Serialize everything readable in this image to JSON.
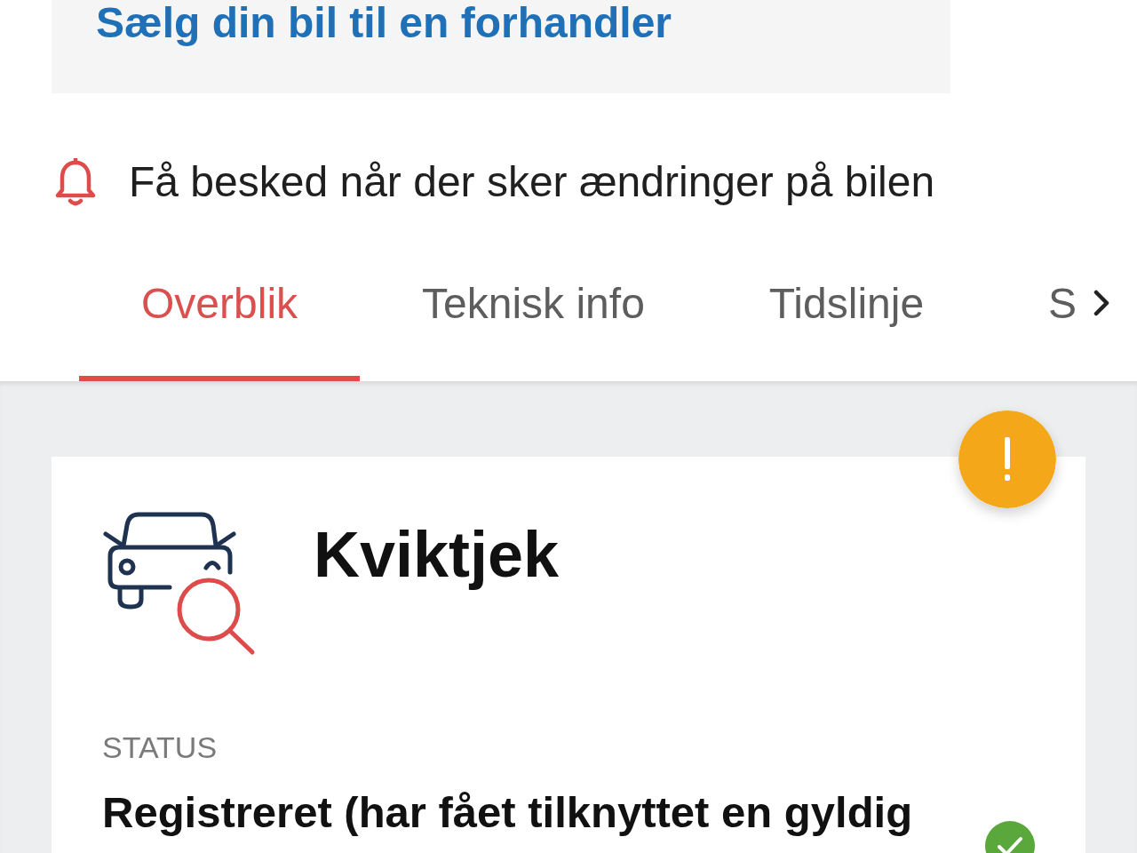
{
  "sell_banner": {
    "link": "Sælg din bil til en forhandler"
  },
  "notification": {
    "label": "Få besked når der sker ændringer på bilen"
  },
  "tabs": [
    {
      "label": "Overblik",
      "selected": true
    },
    {
      "label": "Teknisk info",
      "selected": false
    },
    {
      "label": "Tidslinje",
      "selected": false
    },
    {
      "label": "S",
      "selected": false
    }
  ],
  "card": {
    "title": "Kviktjek",
    "status_label": "STATUS",
    "status_value": "Registreret (har fået tilknyttet en gyldig"
  }
}
